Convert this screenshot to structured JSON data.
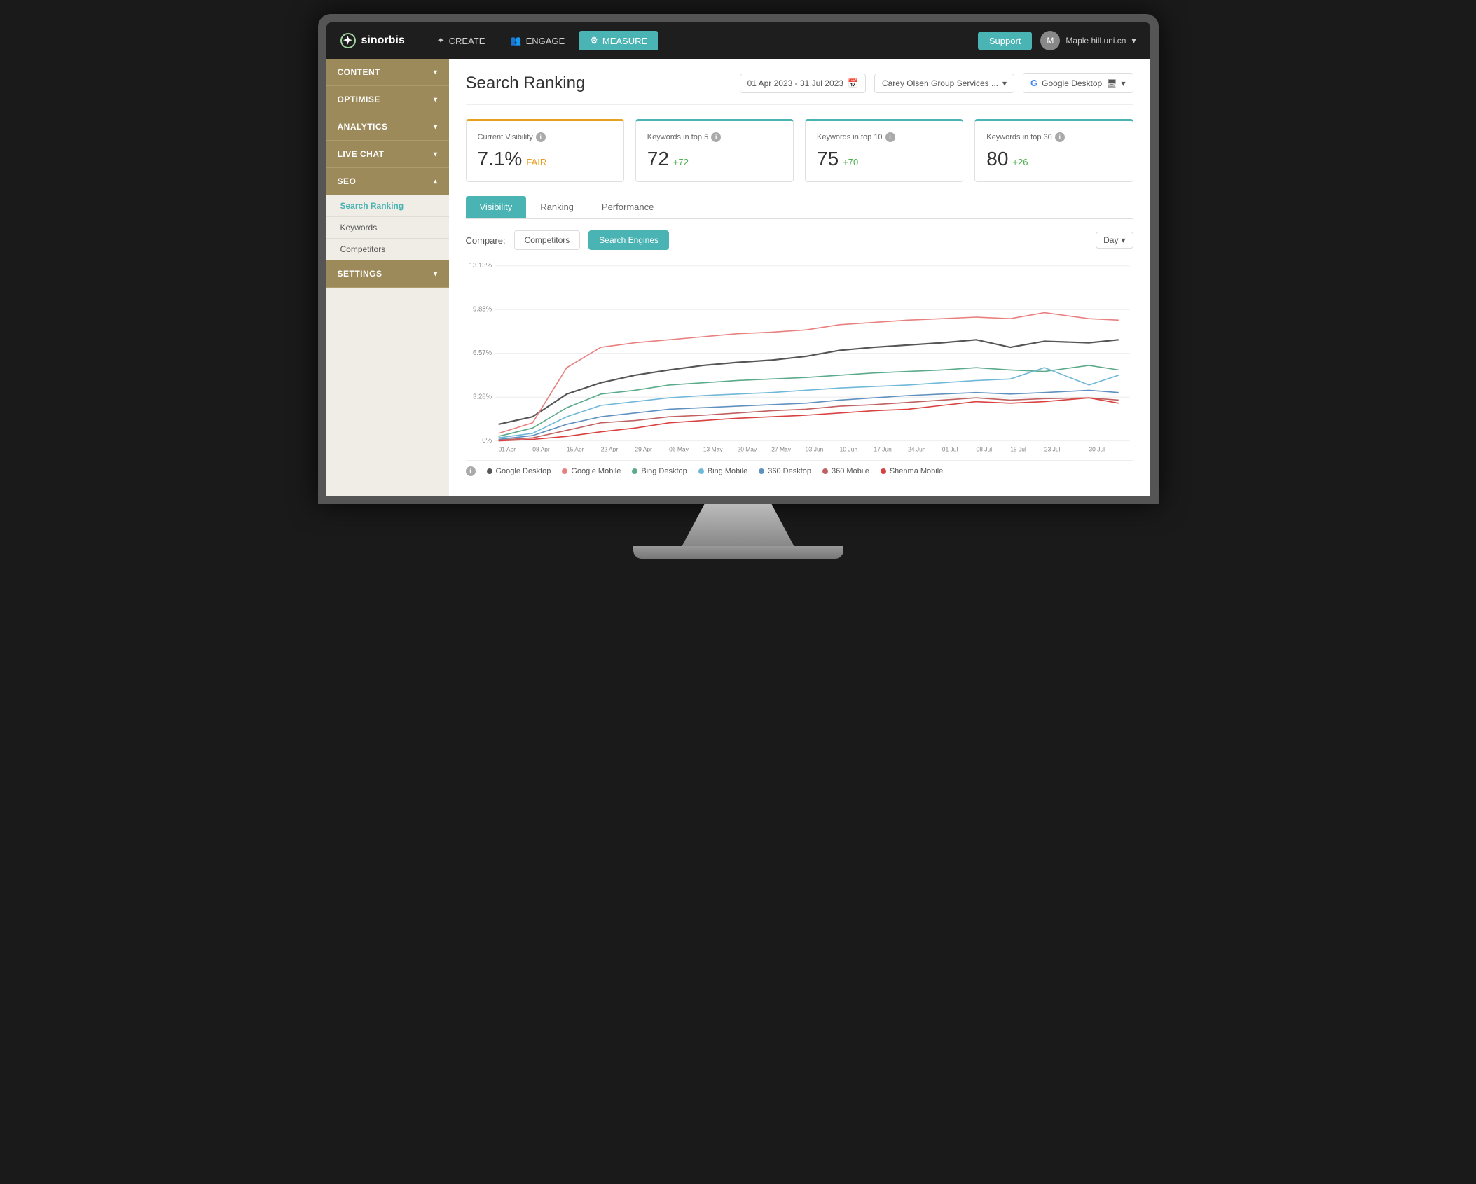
{
  "nav": {
    "logo_text": "sinorbis",
    "items": [
      {
        "label": "CREATE",
        "icon": "✦",
        "active": false
      },
      {
        "label": "ENGAGE",
        "icon": "👥",
        "active": false
      },
      {
        "label": "MEASURE",
        "icon": "⚙",
        "active": true
      }
    ],
    "support_label": "Support",
    "user_name": "Maple hill.uni.cn",
    "user_chevron": "▾"
  },
  "sidebar": {
    "sections": [
      {
        "label": "CONTENT",
        "expanded": false
      },
      {
        "label": "OPTIMISE",
        "expanded": false
      },
      {
        "label": "ANALYTICS",
        "expanded": false
      },
      {
        "label": "LIVE CHAT",
        "expanded": false
      },
      {
        "label": "SEO",
        "expanded": true
      },
      {
        "label": "SETTINGS",
        "expanded": false
      }
    ],
    "seo_items": [
      {
        "label": "Search Ranking",
        "active": true
      },
      {
        "label": "Keywords",
        "active": false
      },
      {
        "label": "Competitors",
        "active": false
      }
    ]
  },
  "page": {
    "title": "Search Ranking",
    "date_range": "01 Apr 2023 - 31 Jul 2023",
    "account": "Carey Olsen Group Services ...",
    "platform": "Google Desktop"
  },
  "stats": [
    {
      "label": "Current Visibility",
      "value": "7.1%",
      "badge": "FAIR",
      "change": null,
      "color": "orange"
    },
    {
      "label": "Keywords in top 5",
      "value": "72",
      "badge": null,
      "change": "+72",
      "color": "teal1"
    },
    {
      "label": "Keywords in top 10",
      "value": "75",
      "badge": null,
      "change": "+70",
      "color": "teal2"
    },
    {
      "label": "Keywords in top 30",
      "value": "80",
      "badge": null,
      "change": "+26",
      "color": "teal3"
    }
  ],
  "tabs": [
    {
      "label": "Visibility",
      "active": true
    },
    {
      "label": "Ranking",
      "active": false
    },
    {
      "label": "Performance",
      "active": false
    }
  ],
  "compare": {
    "label": "Compare:",
    "options": [
      {
        "label": "Competitors",
        "active": false
      },
      {
        "label": "Search Engines",
        "active": true
      }
    ],
    "time_selector": "Day"
  },
  "chart": {
    "y_labels": [
      "13.13%",
      "9.85%",
      "6.57%",
      "3.28%",
      "0%"
    ],
    "x_labels": [
      "01 Apr",
      "08 Apr",
      "15 Apr",
      "22 Apr",
      "29 Apr",
      "06 May",
      "13 May",
      "20 May",
      "27 May",
      "03 Jun",
      "10 Jun",
      "17 Jun",
      "24 Jun",
      "01 Jul",
      "08 Jul",
      "15 Jul",
      "23 Jul",
      "30 Jul"
    ]
  },
  "legend": [
    {
      "label": "Google Desktop",
      "color": "#555555"
    },
    {
      "label": "Google Mobile",
      "color": "#e8a0a0"
    },
    {
      "label": "Bing Desktop",
      "color": "#6cbf9f"
    },
    {
      "label": "Bing Mobile",
      "color": "#7ec8d8"
    },
    {
      "label": "360 Desktop",
      "color": "#7090c0"
    },
    {
      "label": "360 Mobile",
      "color": "#d06060"
    },
    {
      "label": "Shenma Mobile",
      "color": "#e05050"
    }
  ]
}
